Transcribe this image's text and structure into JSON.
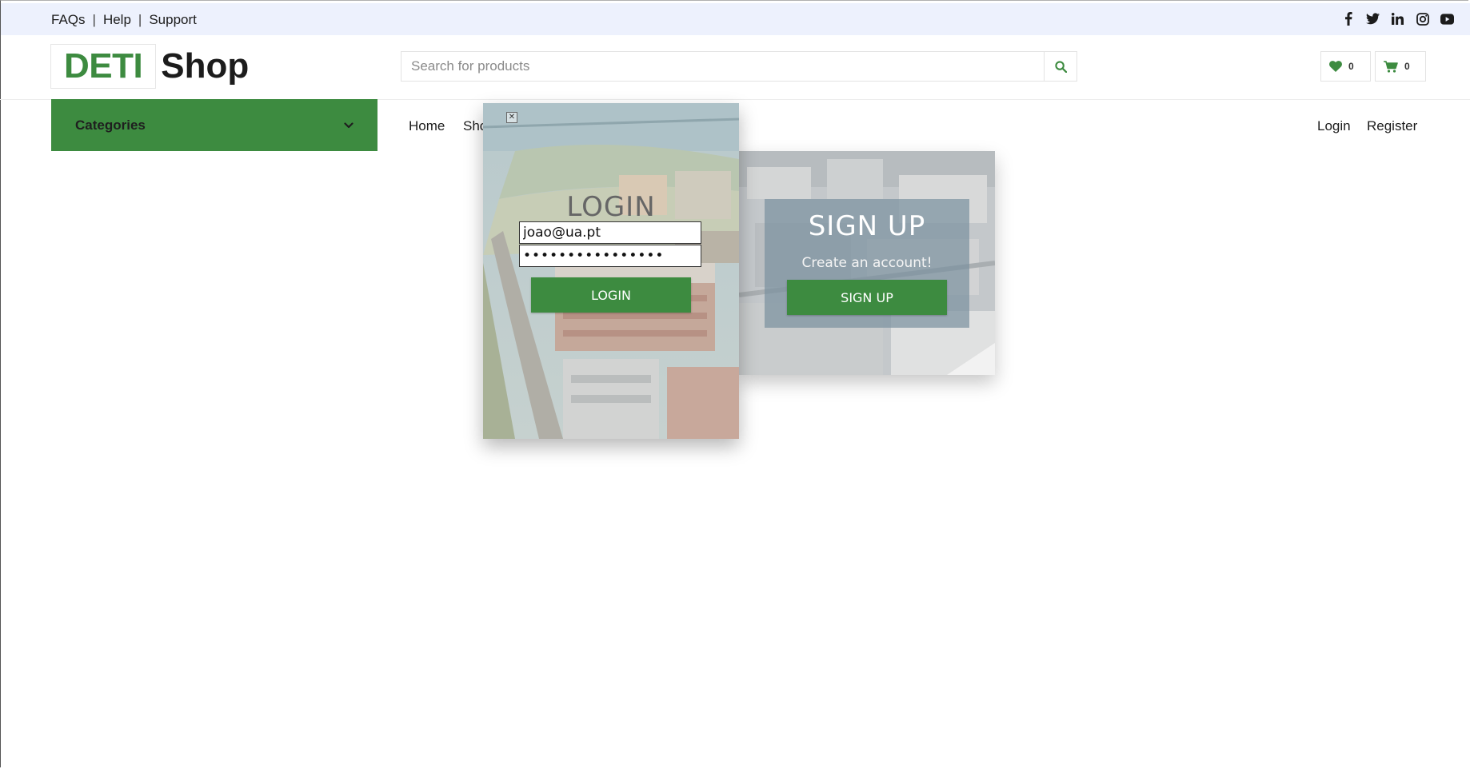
{
  "topbar": {
    "links": [
      "FAQs",
      "Help",
      "Support"
    ],
    "separator": "|",
    "social_icons": [
      "facebook-icon",
      "twitter-icon",
      "linkedin-icon",
      "instagram-icon",
      "youtube-icon"
    ]
  },
  "header": {
    "logo_part1": "DETI",
    "logo_part2": "Shop",
    "search_placeholder": "Search for products",
    "wishlist_count": "0",
    "cart_count": "0"
  },
  "nav": {
    "categories_label": "Categories",
    "links": [
      "Home",
      "Sho"
    ],
    "login": "Login",
    "register": "Register"
  },
  "login_form": {
    "title": "LOGIN",
    "email_value": "joao@ua.pt",
    "password_value": "••••••••••••••••",
    "button": "LOGIN",
    "close_symbol": "✕"
  },
  "signup": {
    "title": "SIGN UP",
    "subtitle": "Create an account!",
    "button": "SIGN UP"
  },
  "colors": {
    "brand_green": "#3d8b40",
    "topbar_bg": "#edf1fd"
  }
}
